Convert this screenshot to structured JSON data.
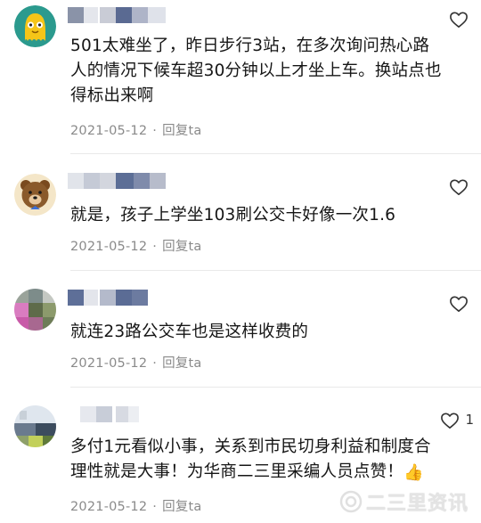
{
  "comments": [
    {
      "text": "501太难坐了，昨日步行3站，在多次询问热心路人的情况下候车超30分钟以上才坐上车。换站点也得标出来啊",
      "date": "2021-05-12",
      "reply_label": "回复ta",
      "avatar_icon": "yellow-octopus-avatar",
      "like_count": ""
    },
    {
      "text": "就是，孩子上学坐103刷公交卡好像一次1.6",
      "date": "2021-05-12",
      "reply_label": "回复ta",
      "avatar_icon": "bear-avatar",
      "like_count": ""
    },
    {
      "text": "就连23路公交车也是这样收费的",
      "date": "2021-05-12",
      "reply_label": "回复ta",
      "avatar_icon": "blurred-photo-avatar",
      "like_count": ""
    },
    {
      "text": "多付1元看似小事，关系到市民切身利益和制度合理性就是大事！为华商二三里采编人员点赞！",
      "emoji": "👍",
      "date": "2021-05-12",
      "reply_label": "回复ta",
      "avatar_icon": "blurred-landscape-avatar",
      "like_count": "1"
    }
  ],
  "watermark": {
    "text": "二三里资讯",
    "icon": "ersanli-logo"
  },
  "colors": {
    "text": "#161616",
    "meta": "#8a8a8a",
    "divider": "#e9e9e9",
    "avatar1_bg": "#2b9a8e",
    "avatar1_fg": "#f5c518",
    "avatar2_bg": "#8a5a2b"
  }
}
